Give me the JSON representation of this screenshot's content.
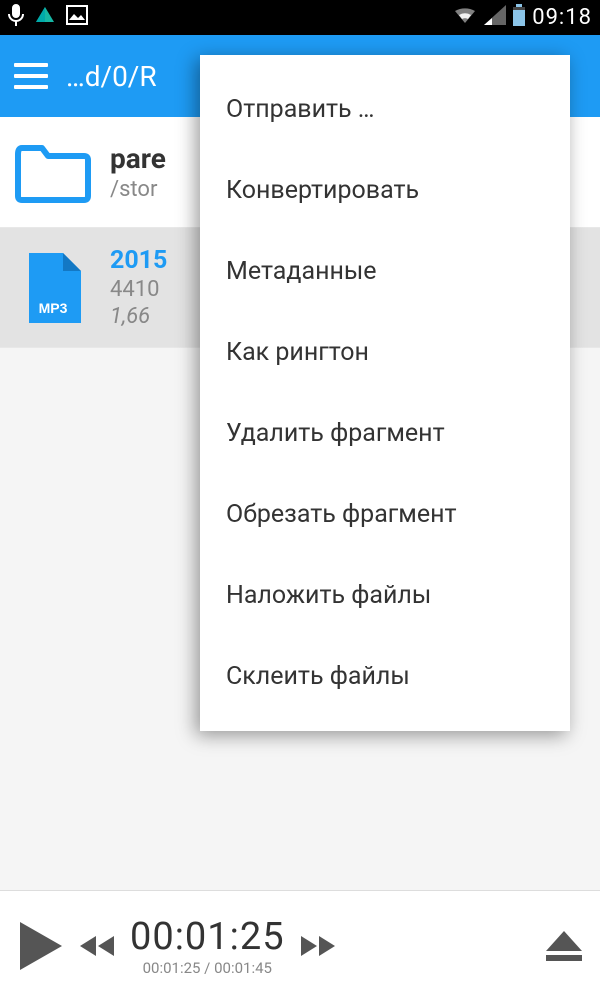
{
  "status": {
    "time": "09:18"
  },
  "appbar": {
    "path": "…d/0/R"
  },
  "rows": {
    "parent": {
      "title": "pare",
      "subtitle": "/stor"
    },
    "file": {
      "title": "2015",
      "subtitle": "4410",
      "size": "1,66 "
    }
  },
  "menu": {
    "items": [
      "Отправить …",
      "Конвертировать",
      "Метаданные",
      "Как рингтон",
      "Удалить фрагмент",
      "Обрезать фрагмент",
      "Наложить файлы",
      "Склеить файлы"
    ]
  },
  "player": {
    "time_main": "00:01:25",
    "time_sub": "00:01:25 / 00:01:45"
  },
  "colors": {
    "accent": "#1e9bf4"
  }
}
